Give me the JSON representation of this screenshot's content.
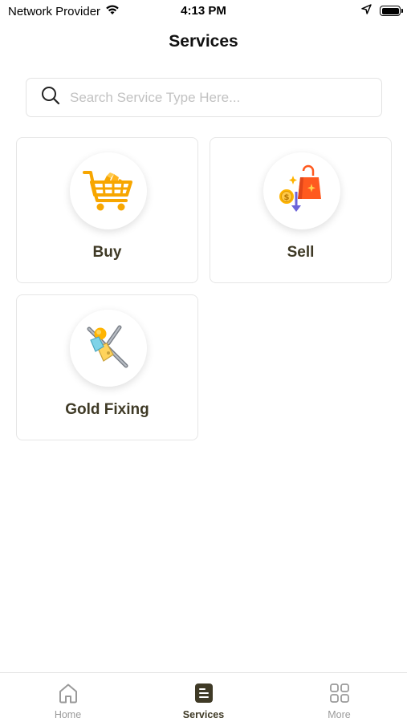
{
  "status_bar": {
    "carrier": "Network Provider",
    "time": "4:13 PM"
  },
  "header": {
    "title": "Services"
  },
  "search": {
    "placeholder": "Search Service Type Here..."
  },
  "services": [
    {
      "label": "Buy",
      "icon": "shopping-cart-gold-icon"
    },
    {
      "label": "Sell",
      "icon": "shopping-bag-coin-icon"
    },
    {
      "label": "Gold Fixing",
      "icon": "tools-wrench-icon"
    }
  ],
  "tab_bar": {
    "items": [
      {
        "label": "Home",
        "icon": "home-icon",
        "active": false
      },
      {
        "label": "Services",
        "icon": "services-document-icon",
        "active": true
      },
      {
        "label": "More",
        "icon": "grid-icon",
        "active": false
      }
    ]
  },
  "colors": {
    "accent": "#3f3a26",
    "gold": "#f7a600",
    "orange": "#ff5a1f",
    "inactive": "#9a9a9a"
  }
}
